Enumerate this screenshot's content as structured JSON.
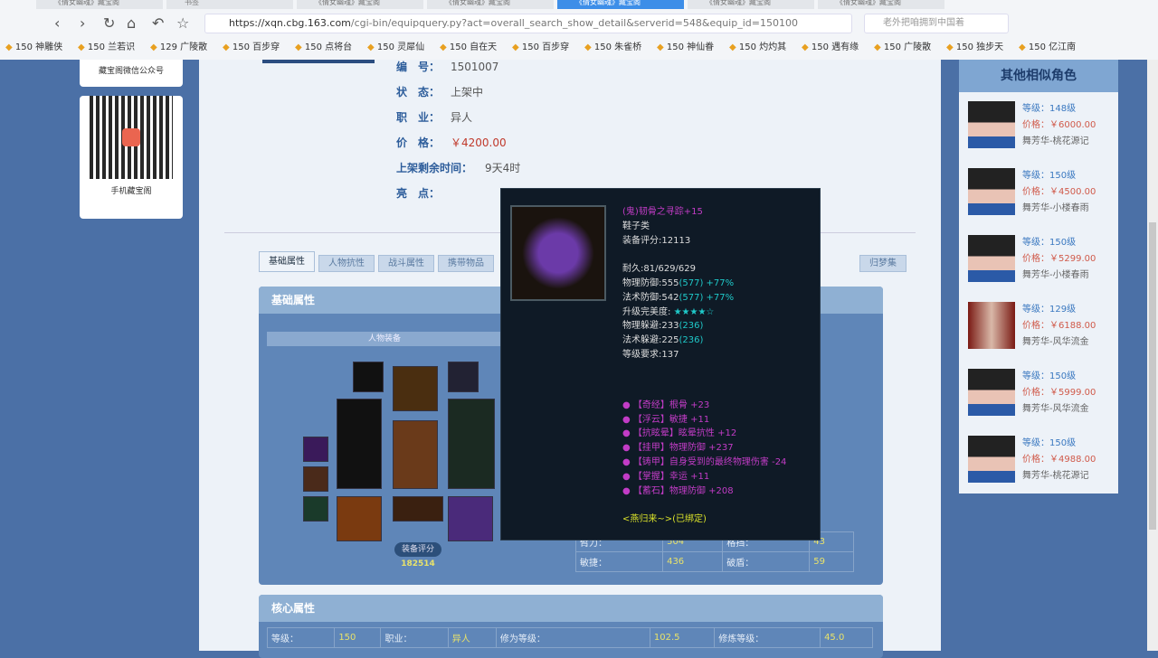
{
  "browser": {
    "tabs": [
      "《倩女幽魂》藏宝阁",
      "书签",
      "《倩女幽魂》藏宝阁",
      "《倩女幽魂》藏宝阁",
      "《倩女幽魂》藏宝阁",
      "《倩女幽魂》藏宝阁",
      "《倩女幽魂》藏宝阁"
    ],
    "url_host": "https://xqn.cbg.163.com",
    "url_path": "/cgi-bin/equipquery.py?act=overall_search_show_detail&serverid=548&equip_id=150100",
    "search_placeholder": "老外把咱拥到中国着",
    "bookmarks": [
      "150 神雕侠",
      "150 兰若识",
      "129 广陵散",
      "150 百步穿",
      "150 点将台",
      "150 灵犀仙",
      "150 自在天",
      "150 百步穿",
      "150 朱雀桥",
      "150 神仙眷",
      "150 灼灼其",
      "150 遇有缘",
      "150 广陵散",
      "150 独步天",
      "150 亿江南"
    ]
  },
  "left": {
    "wechat_label": "藏宝阁微信公众号",
    "app_label": "手机藏宝阁"
  },
  "info": {
    "rows": [
      {
        "k": "编　号：",
        "v": "1501007"
      },
      {
        "k": "状　态：",
        "v": "上架中"
      },
      {
        "k": "职　业：",
        "v": "异人"
      },
      {
        "k": "价　格：",
        "v": "￥4200.00"
      },
      {
        "k": "上架剩余时间：",
        "v": "9天4时"
      },
      {
        "k": "亮　点：",
        "v": ""
      }
    ]
  },
  "tabs": [
    "基础属性",
    "人物抗性",
    "战斗属性",
    "携带物品",
    "",
    "",
    "",
    "",
    "",
    "",
    "归梦集"
  ],
  "basic": {
    "title": "基础属性",
    "equip_header": "人物装备",
    "score_label": "装备评分",
    "score": "182514",
    "stats": [
      [
        "臂力：",
        "504",
        "格挡：",
        "43"
      ],
      [
        "敏捷：",
        "436",
        "破盾：",
        "59"
      ]
    ]
  },
  "core": {
    "title": "核心属性",
    "row": [
      "等级：",
      "150",
      "职业：",
      "异人",
      "修为等级：",
      "102.5",
      "修炼等级：",
      "45.0"
    ]
  },
  "tooltip": {
    "name": "(鬼)韧骨之寻踪+15",
    "type": "鞋子类",
    "score": "装备评分:12113",
    "durability": "耐久:81/629/629",
    "pdef": "物理防御:555",
    "pdef_b": "(577) +77%",
    "mdef": "法术防御:542",
    "mdef_b": "(577) +77%",
    "perfect": "升级完美度:",
    "stars": "★★★★☆",
    "pdodge": "物理躲避:233",
    "pdodge_b": "(236)",
    "mdodge": "法术躲避:225",
    "mdodge_b": "(236)",
    "req": "等级要求:137",
    "affixes": [
      "【奇经】根骨 +23",
      "【浮云】敏捷 +11",
      "【抗眩晕】眩晕抗性 +12",
      "【挂甲】物理防御 +237",
      "【铸甲】自身受到的最终物理伤害 -24",
      "【掌握】幸运 +11",
      "【蓄石】物理防御 +208"
    ],
    "bound": "<燕归来~>(已绑定)"
  },
  "similar": {
    "title": "其他相似角色",
    "items": [
      {
        "lv": "等级：148级",
        "price": "价格：￥6000.00",
        "server": "舞芳华-桃花源记"
      },
      {
        "lv": "等级：150级",
        "price": "价格：￥4500.00",
        "server": "舞芳华-小楼春雨"
      },
      {
        "lv": "等级：150级",
        "price": "价格：￥5299.00",
        "server": "舞芳华-小楼春雨"
      },
      {
        "lv": "等级：129级",
        "price": "价格：￥6188.00",
        "server": "舞芳华-风华流金"
      },
      {
        "lv": "等级：150级",
        "price": "价格：￥5999.00",
        "server": "舞芳华-风华流金"
      },
      {
        "lv": "等级：150级",
        "price": "价格：￥4988.00",
        "server": "舞芳华-桃花源记"
      }
    ]
  }
}
